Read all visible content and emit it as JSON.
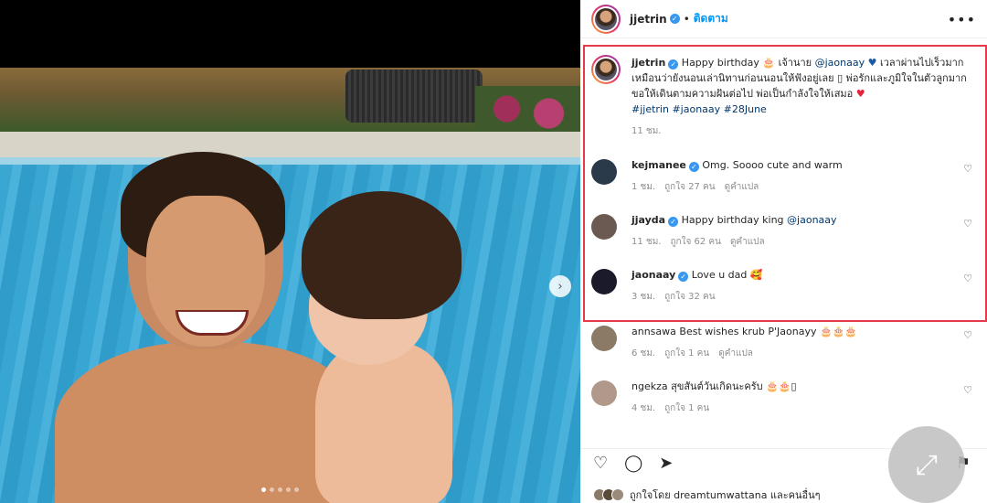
{
  "post": {
    "username": "jjetrin",
    "separator": "•",
    "follow_label": "ติดตาม",
    "more_label": "•••",
    "caption": {
      "username": "jjetrin",
      "text_1": "Happy birthday",
      "text_2": "เจ้านาย",
      "mention": "@jaonaay",
      "text_3": "เวลาผ่านไปเร็วมาก เหมือนว่ายังนอนเล่านิทานก่อนนอนให้ฟังอยู่เลย",
      "text_4": "พ่อรักและภูมิใจในตัวลูกมาก ขอให้เดินตามความฝันต่อไป พ่อเป็นกำลังใจให้เสมอ",
      "hashtags": "#jjetrin #jaonaay #28June",
      "time": "11 ชม."
    }
  },
  "comments": [
    {
      "username": "kejmanee",
      "verified": true,
      "text": "Omg. Soooo cute and warm",
      "time": "1 ชม.",
      "likes": "ถูกใจ 27 คน",
      "translate": "ดูคำแปล",
      "avatar_color": "#2a3a4a"
    },
    {
      "username": "jjayda",
      "verified": true,
      "text": "Happy birthday king",
      "mention": "@jaonaay",
      "time": "11 ชม.",
      "likes": "ถูกใจ 62 คน",
      "translate": "ดูคำแปล",
      "avatar_color": "#6a5a52"
    },
    {
      "username": "jaonaay",
      "verified": true,
      "text": "Love u dad",
      "time": "3 ชม.",
      "likes": "ถูกใจ 32 คน",
      "avatar_color": "#1a1a2a"
    },
    {
      "username": "annsawa",
      "verified": false,
      "text": "Best wishes krub P'Jaonayy",
      "time": "6 ชม.",
      "likes": "ถูกใจ 1 คน",
      "translate": "ดูคำแปล",
      "avatar_color": "#8a7a66"
    },
    {
      "username": "ngekza",
      "verified": false,
      "text": "สุขสันต์วันเกิดนะครับ",
      "time": "4 ชม.",
      "likes": "ถูกใจ 1 คน",
      "avatar_color": "#b0988a"
    }
  ],
  "footer": {
    "liked_by": "ถูกใจโดย dreamtumwattana และคนอื่นๆ"
  },
  "icons": {
    "heart": "♡",
    "comment": "◯",
    "share": "➤",
    "bookmark": "⚑",
    "expand": "⤢",
    "next": "›"
  },
  "colors": {
    "accent": "#0095f6",
    "verified": "#3897f0",
    "highlight": "#e53a4a"
  }
}
